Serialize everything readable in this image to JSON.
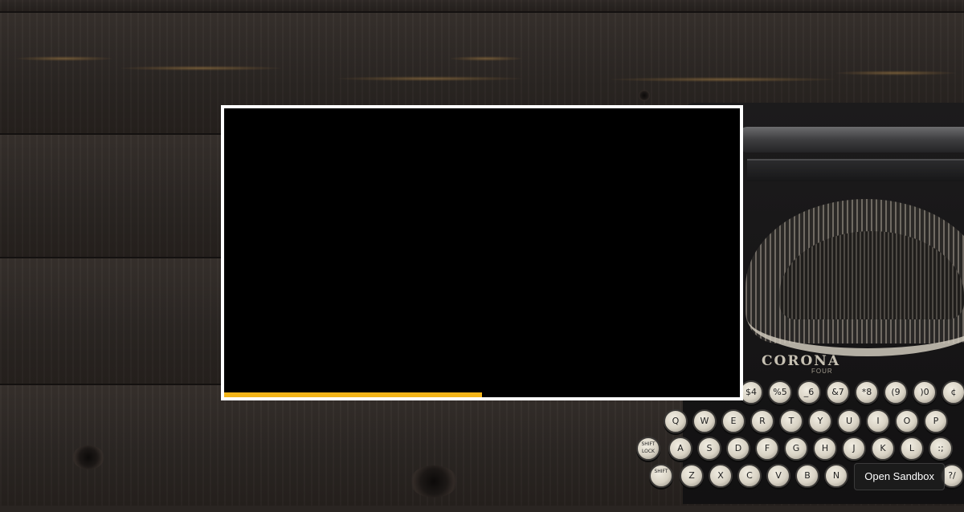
{
  "background": {
    "description_icon": "wooden-planks",
    "colors": {
      "wood_dark": "#2b2623",
      "wood_light": "#37312d"
    }
  },
  "typewriter": {
    "brand": "CORONA",
    "brand_sub": "FOUR",
    "keys_row1": [
      "$4",
      "%5",
      "_6",
      "&7",
      "*8",
      "(9",
      ")0",
      "¢"
    ],
    "keys_row2": [
      "Q",
      "W",
      "E",
      "R",
      "T",
      "Y",
      "U",
      "I",
      "O",
      "P"
    ],
    "keys_row3": [
      "SHIFT LOCK",
      "A",
      "S",
      "D",
      "F",
      "G",
      "H",
      "J",
      "K",
      "L",
      ":;"
    ],
    "keys_row4": [
      "SHIFT",
      "Z",
      "X",
      "C",
      "V",
      "B",
      "N",
      "?/"
    ]
  },
  "video": {
    "progress": 0.5,
    "progress_color": "#f3b418",
    "frame_color": "#ffffff"
  },
  "sandbox_button": {
    "label": "Open Sandbox"
  }
}
